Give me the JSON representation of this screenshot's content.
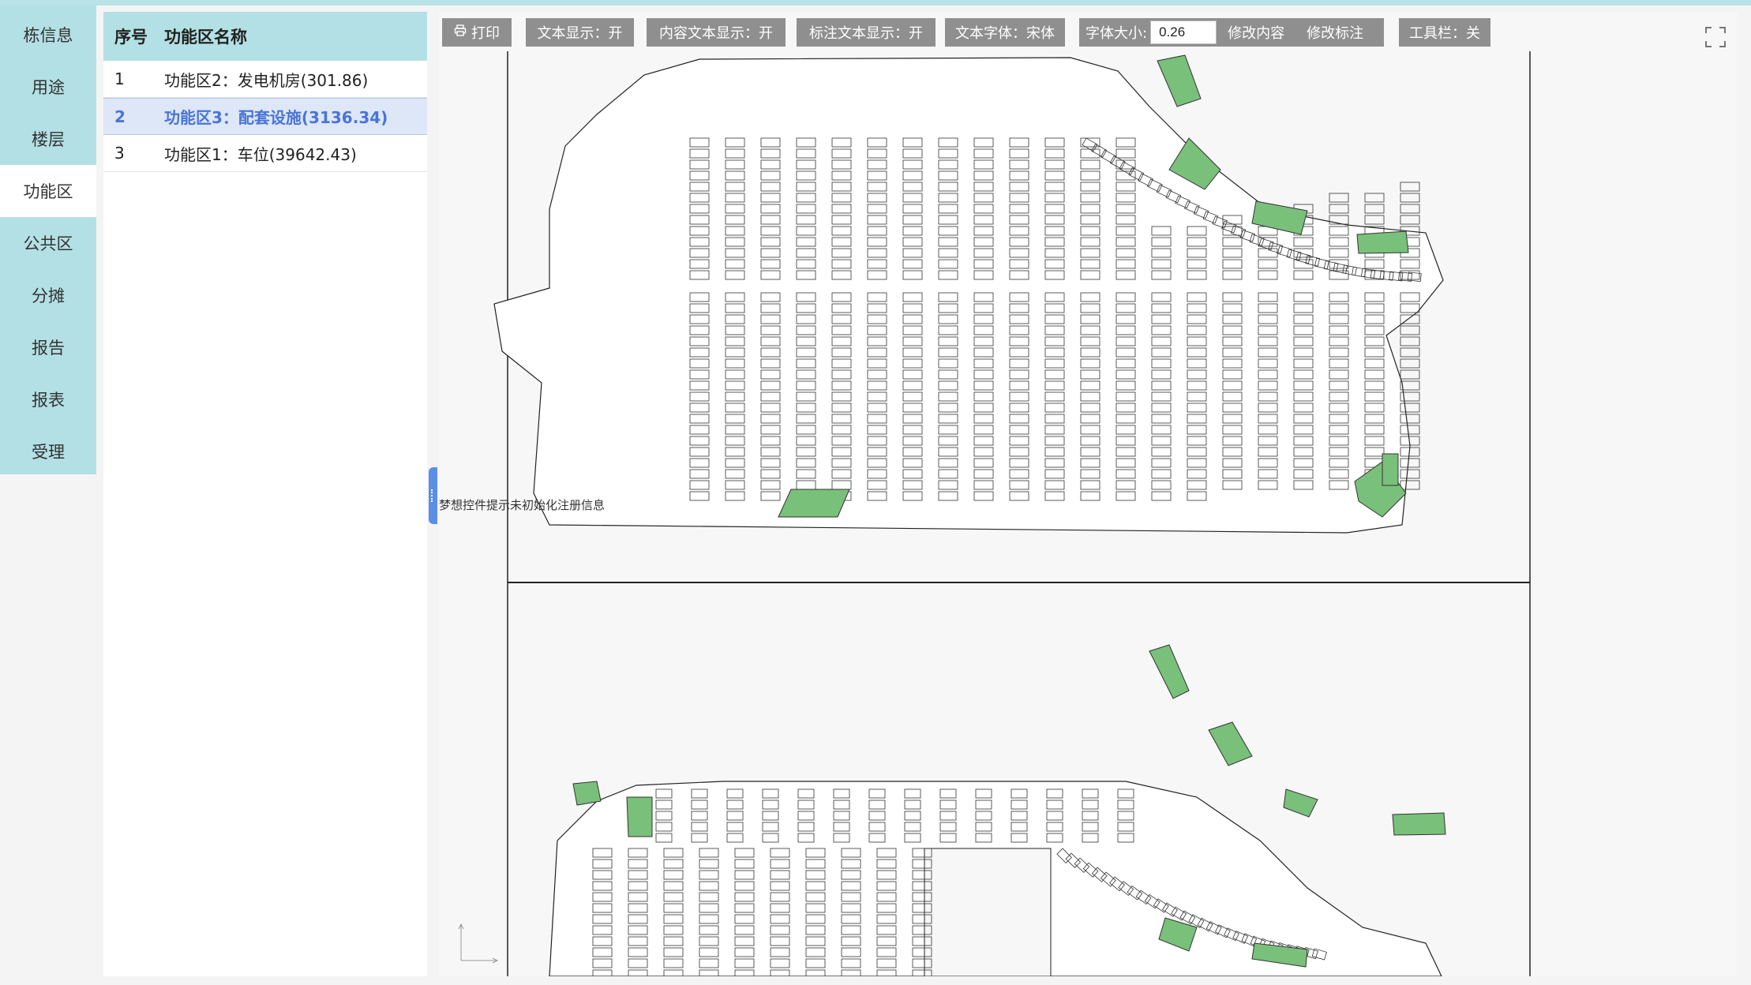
{
  "nav": {
    "items": [
      {
        "label": "栋信息"
      },
      {
        "label": "用途"
      },
      {
        "label": "楼层"
      },
      {
        "label": "功能区"
      },
      {
        "label": "公共区"
      },
      {
        "label": "分摊"
      },
      {
        "label": "报告"
      },
      {
        "label": "报表"
      },
      {
        "label": "受理"
      }
    ],
    "active": "功能区"
  },
  "list": {
    "headers": {
      "index": "序号",
      "name": "功能区名称"
    },
    "rows": [
      {
        "index": "1",
        "name": "功能区2：发电机房(301.86)"
      },
      {
        "index": "2",
        "name": "功能区3：配套设施(3136.34)"
      },
      {
        "index": "3",
        "name": "功能区1：车位(39642.43)"
      }
    ],
    "selected_index": "2"
  },
  "toolbar": {
    "print": "打印",
    "text_display": "文本显示：开",
    "content_text_display": "内容文本显示：开",
    "annotation_text_display": "标注文本显示：开",
    "text_font": "文本字体：宋体",
    "font_size_label": "字体大小:",
    "font_size_value": "0.26",
    "modify_content": "修改内容",
    "modify_annotation": "修改标注",
    "toolbar_toggle": "工具栏：关"
  },
  "canvas": {
    "warning": "梦想控件提示未初始化注册信息"
  },
  "colors": {
    "nav_bg": "#b3e0e5",
    "selected_row_bg": "#dde7f8",
    "selected_row_text": "#4a74d6",
    "toolbar_btn": "#8f8f8f",
    "highlight_fill": "#79c07a"
  },
  "icons": [
    "printer-icon",
    "fullscreen-icon",
    "splitter-grip-icon"
  ]
}
